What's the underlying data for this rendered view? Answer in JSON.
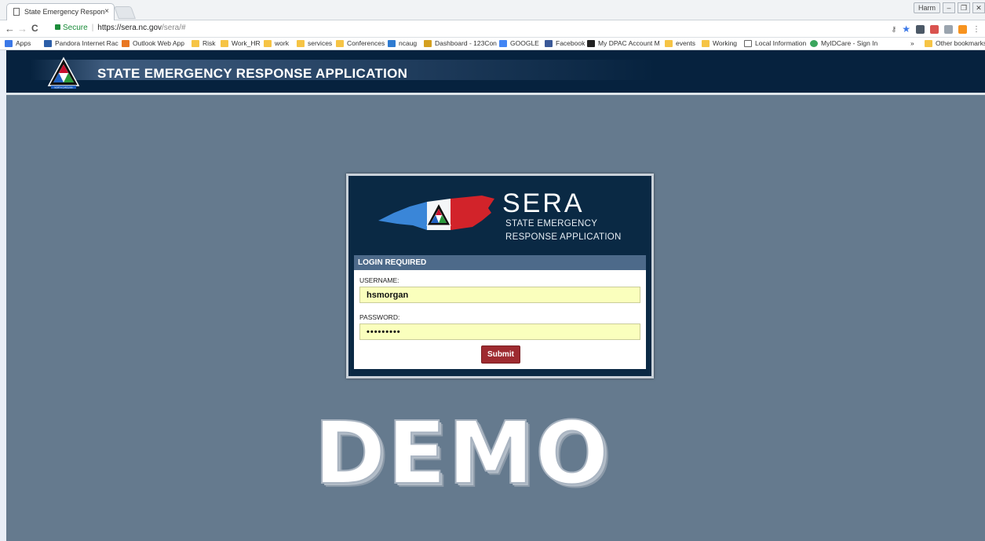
{
  "browser": {
    "tab_title": "State Emergency Respon",
    "tab_close": "×",
    "window_user": "Harm",
    "minimize": "–",
    "restore": "❐",
    "close": "✕",
    "back": "←",
    "forward": "→",
    "reload": "C",
    "secure_label": "Secure",
    "url_host": "https://sera.nc.gov",
    "url_path": "/sera/#"
  },
  "bookmarks": {
    "apps": "Apps",
    "items": [
      "Pandora Internet Rac",
      "Outlook Web App",
      "Risk",
      "Work_HR",
      "work",
      "services",
      "Conferences",
      "ncaug",
      "Dashboard - 123Con",
      "GOOGLE",
      "Facebook",
      "My DPAC Account M",
      "events",
      "Working",
      "Local Information",
      "MyIDCare - Sign In"
    ],
    "overflow": "»",
    "other": "Other bookmarks"
  },
  "app": {
    "title": "STATE EMERGENCY RESPONSE APPLICATION",
    "logo_caption": "NORTH CAROLINA"
  },
  "login": {
    "sera": "SERA",
    "sub_line1": "STATE EMERGENCY",
    "sub_line2": "RESPONSE APPLICATION",
    "header": "LOGIN REQUIRED",
    "username_label": "USERNAME:",
    "username_value": "hsmorgan",
    "password_label": "PASSWORD:",
    "password_value": "•••••••••",
    "submit_label": "Submit"
  },
  "watermark": "DEMO",
  "colors": {
    "header_bg": "#06223e",
    "page_bg": "#657a8e",
    "panel_bg": "#0a2944",
    "login_head": "#4d6a8a",
    "input_bg": "#faffbd",
    "submit_bg": "#9e2b30"
  }
}
